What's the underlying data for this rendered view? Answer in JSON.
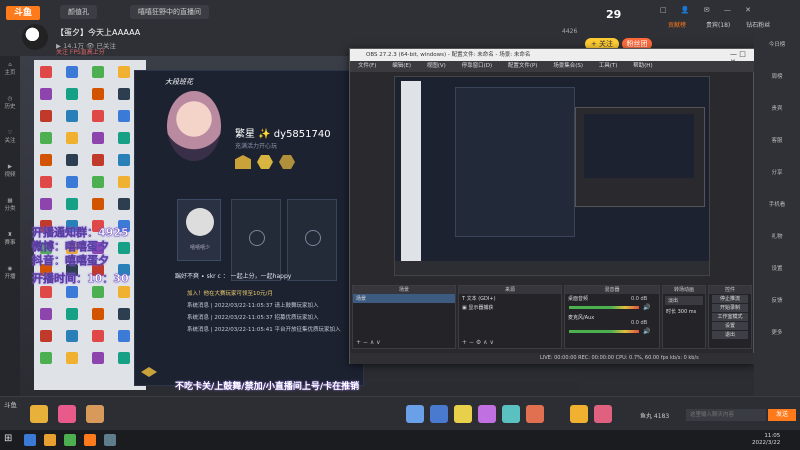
{
  "header": {
    "logo": "斗鱼",
    "tabs": [
      "颜值孔",
      "嘻嘻狂野中的直播间"
    ],
    "room_title": "【蛋夕】今天上AAAAA",
    "stats": "▶ 14.1万   👁 已关注",
    "tags": "关注   FPS直高上分",
    "temperature": "29",
    "follow_label": "+ 关注",
    "fans_label": "粉丝团",
    "room_id": "4426",
    "window_icons": "□ 👤 ✉ — ✕"
  },
  "leftnav": [
    {
      "icon": "home-icon",
      "label": "主页"
    },
    {
      "icon": "history-icon",
      "label": "历史"
    },
    {
      "icon": "follow-icon",
      "label": "关注"
    },
    {
      "icon": "video-icon",
      "label": "视频"
    },
    {
      "icon": "category-icon",
      "label": "分类"
    },
    {
      "icon": "match-icon",
      "label": "赛事"
    },
    {
      "icon": "live-icon",
      "label": "开播"
    }
  ],
  "game_panel": {
    "rank_label": "大段班花",
    "player_name": "繁星 ✨ dy5851740",
    "player_sub": "充满活力开心玩",
    "card_caption": "嘻嘻嘻少",
    "banner": "踹好不爽 ∙ skr  c ：  一起上分，一起happy",
    "system_lines": [
      "加入！他在大赛玩家可领至10元/月",
      "系统消息 | 2022/03/22-11:05:37 请上鼓舞玩家加入",
      "系统消息 | 2022/03/22-11:05:37 招募优质玩家加入",
      "系统消息 | 2022/03/22-11:05:41 平台开放征集优质玩家加入"
    ]
  },
  "overlay_texts": [
    "开播通知群：4925",
    "微博：嘻嘻蛋夕",
    "抖音：嘻嘻蛋夕",
    "开播时间：10：30"
  ],
  "overlay_bottom": "不吃卡关/上鼓舞/禁加/小直播间上号/卡在推销",
  "obs": {
    "title": "OBS 27.2.3 (64-bit, windows) - 配置文件: 未命名 - 场景: 未命名",
    "menu": [
      "文件(F)",
      "编辑(E)",
      "视图(V)",
      "停靠窗口(D)",
      "配置文件(P)",
      "场景集合(S)",
      "工具(T)",
      "帮助(H)"
    ],
    "docks": {
      "scenes": {
        "title": "场景",
        "items": [
          "场景"
        ]
      },
      "sources": {
        "title": "来源",
        "items": [
          "T 文本 (GDI+)",
          "▣ 显示器捕获"
        ]
      },
      "mixer": {
        "title": "混音器",
        "items": [
          "桌面音频",
          "麦克风/Aux"
        ],
        "levels": [
          "0.0 dB",
          "0.0 dB"
        ]
      },
      "transitions": {
        "title": "转场动画",
        "mode": "淡出",
        "duration_label": "时长",
        "duration": "300 ms"
      },
      "controls": {
        "title": "控件",
        "buttons": [
          "停止推流",
          "开始录制",
          "工作室模式",
          "设置",
          "退出"
        ]
      }
    },
    "status": "LIVE: 00:00:00   REC: 00:00:00   CPU: 0.7%, 60.00 fps   kb/s: 0 kb/s"
  },
  "rightbar": {
    "tabs": [
      "贡献榜",
      "贵宾(18)",
      "钻石粉丝"
    ],
    "items": [
      "今日榜",
      "周榜",
      "贵宾",
      "客服",
      "分享",
      "手机看",
      "礼物",
      "设置",
      "反馈",
      "更多"
    ]
  },
  "bottombar": {
    "left_label": "斗鱼",
    "balance_label": "鱼丸  4183",
    "chat_placeholder": "这里输入聊天内容",
    "send_label": "发送"
  },
  "clock": {
    "time": "11:05",
    "date": "2022/3/22"
  }
}
